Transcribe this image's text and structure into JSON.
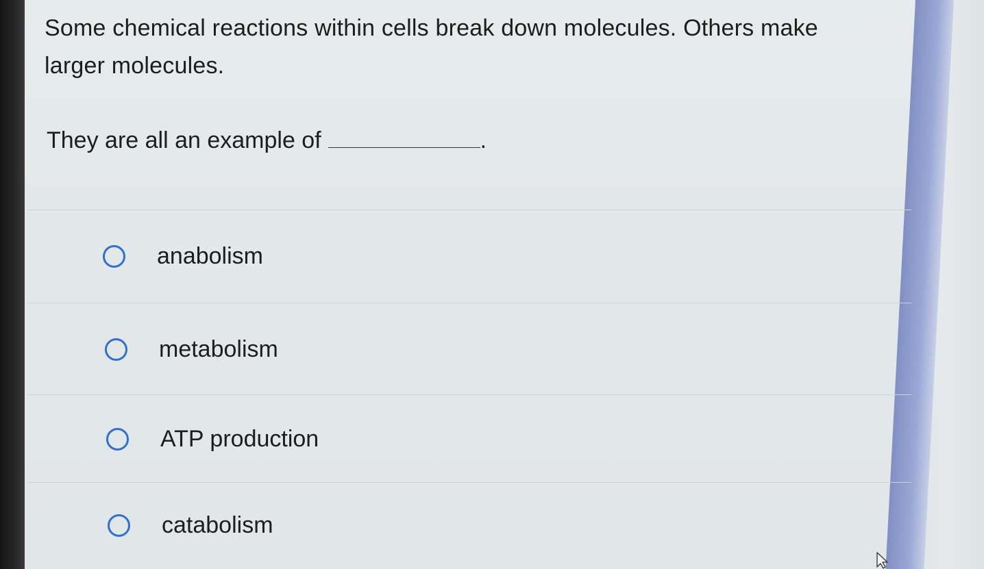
{
  "question": {
    "text": "Some chemical reactions within cells break down molecules. Others make larger molecules.",
    "prompt": "They are all an example of",
    "blank_suffix": "."
  },
  "options": [
    {
      "label": "anabolism"
    },
    {
      "label": "metabolism"
    },
    {
      "label": "ATP production"
    },
    {
      "label": "catabolism"
    }
  ],
  "colors": {
    "radio_border": "#2f6fd6",
    "scrollbar_thumb": "#8190c3",
    "text": "#1d1d1d"
  },
  "icons": {
    "radio": "radio-unselected-icon",
    "cursor": "mouse-pointer-icon"
  }
}
